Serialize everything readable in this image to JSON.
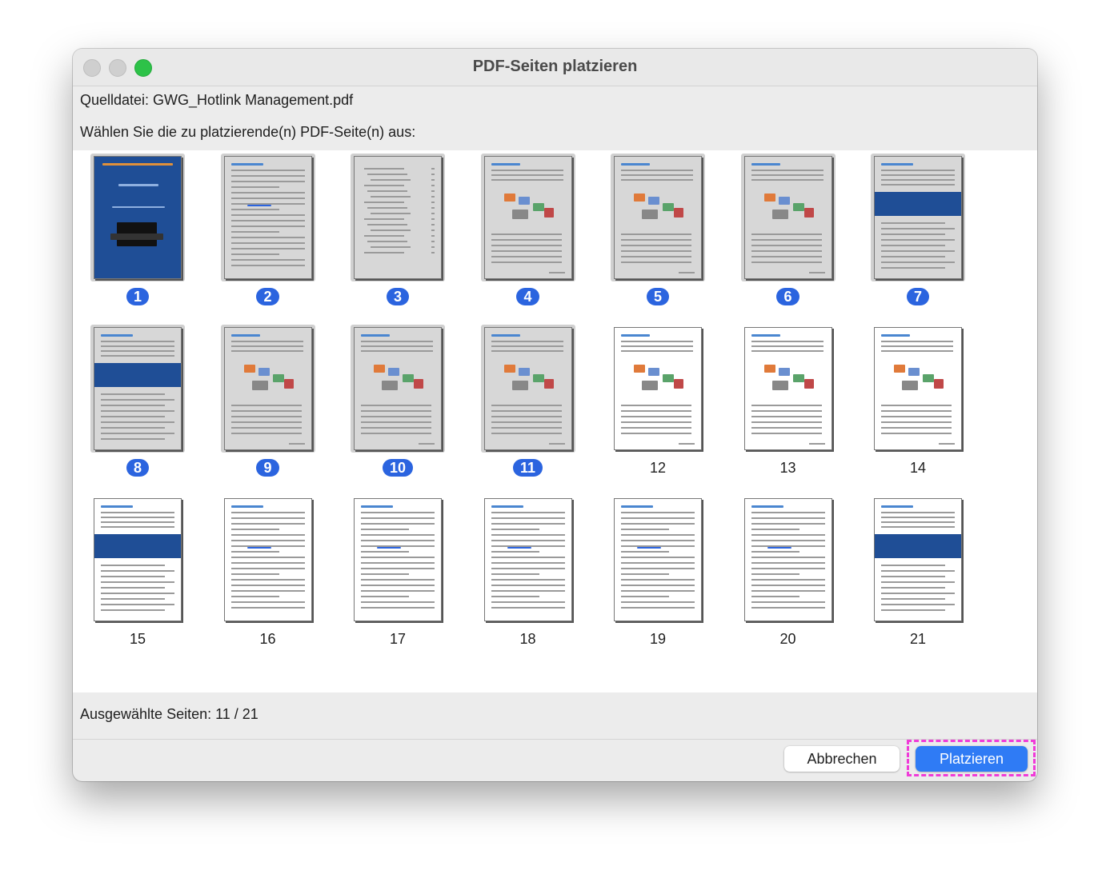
{
  "window": {
    "title": "PDF-Seiten platzieren"
  },
  "source_label": "Quelldatei: GWG_Hotlink Management.pdf",
  "prompt_label": "Wählen Sie die zu platzierende(n) PDF-Seite(n) aus:",
  "selection_status": "Ausgewählte Seiten: 11 / 21",
  "buttons": {
    "cancel": "Abbrechen",
    "place": "Platzieren"
  },
  "colors": {
    "selection_badge": "#2b64df",
    "primary_button": "#2f7bf5",
    "cover": "#1f4e96",
    "highlight": "#f03bd8"
  },
  "pages": [
    {
      "number": "1",
      "selected": true,
      "kind": "cover"
    },
    {
      "number": "2",
      "selected": true,
      "kind": "text"
    },
    {
      "number": "3",
      "selected": true,
      "kind": "toc"
    },
    {
      "number": "4",
      "selected": true,
      "kind": "diagram"
    },
    {
      "number": "5",
      "selected": true,
      "kind": "diagram"
    },
    {
      "number": "6",
      "selected": true,
      "kind": "diagram"
    },
    {
      "number": "7",
      "selected": true,
      "kind": "band"
    },
    {
      "number": "8",
      "selected": true,
      "kind": "band"
    },
    {
      "number": "9",
      "selected": true,
      "kind": "diagram"
    },
    {
      "number": "10",
      "selected": true,
      "kind": "diagram"
    },
    {
      "number": "11",
      "selected": true,
      "kind": "diagram"
    },
    {
      "number": "12",
      "selected": false,
      "kind": "diagram"
    },
    {
      "number": "13",
      "selected": false,
      "kind": "diagram"
    },
    {
      "number": "14",
      "selected": false,
      "kind": "diagram"
    },
    {
      "number": "15",
      "selected": false,
      "kind": "band"
    },
    {
      "number": "16",
      "selected": false,
      "kind": "text"
    },
    {
      "number": "17",
      "selected": false,
      "kind": "text"
    },
    {
      "number": "18",
      "selected": false,
      "kind": "text"
    },
    {
      "number": "19",
      "selected": false,
      "kind": "text"
    },
    {
      "number": "20",
      "selected": false,
      "kind": "text"
    },
    {
      "number": "21",
      "selected": false,
      "kind": "band"
    }
  ]
}
